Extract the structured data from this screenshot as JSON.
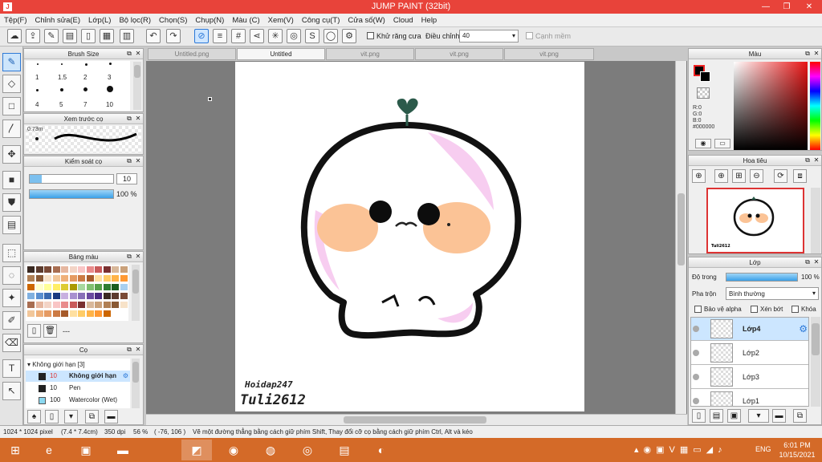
{
  "title": "JUMP PAINT (32bit)",
  "menu": [
    "Tệp(F)",
    "Chỉnh sửa(E)",
    "Lớp(L)",
    "Bộ lọc(R)",
    "Chọn(S)",
    "Chụp(N)",
    "Màu (C)",
    "Xem(V)",
    "Công cụ(T)",
    "Cửa số(W)",
    "Cloud",
    "Help"
  ],
  "toolbar": {
    "antialias_label": "Khử răng cưa",
    "adjust_label": "Điều chỉnh",
    "brush_value": "40",
    "edge_label": "Cạnh mềm"
  },
  "tabs": [
    "Untitled.png",
    "Untitled",
    "vit.png",
    "vit.png",
    "vit.png"
  ],
  "brush_size": {
    "title": "Brush Size",
    "labels": [
      "1",
      "1.5",
      "2",
      "3",
      "4",
      "5",
      "7",
      "10"
    ]
  },
  "preview": {
    "title": "Xem trước cọ",
    "size": "0.73m"
  },
  "control": {
    "title": "Kiểm soát cọ",
    "size": "10",
    "opacity": "100 %",
    "opacity_fraction": 1.0
  },
  "palette": {
    "title": "Bảng màu",
    "more": "---"
  },
  "brush_list": {
    "title": "Cọ",
    "group": "Không giới hạn [3]",
    "items": [
      {
        "size": "10",
        "name": "Không giới hạn"
      },
      {
        "size": "10",
        "name": "Pen"
      },
      {
        "size": "100",
        "name": "Watercolor (Wet)"
      }
    ]
  },
  "color": {
    "title": "Màu",
    "r": "R:0",
    "g": "G:0",
    "b": "B:0",
    "hex": "#000000"
  },
  "navigator": {
    "title": "Hoa tiêu"
  },
  "layers": {
    "title": "Lớp",
    "opacity_label": "Độ trong",
    "opacity": "100 %",
    "opacity_fraction": 1.0,
    "blend_label": "Pha trộn",
    "blend": "Bình thường",
    "protect_alpha": "Bảo vệ alpha",
    "clipping": "Xén bớt",
    "lock": "Khóa",
    "items": [
      "Lớp4",
      "Lớp2",
      "Lớp3",
      "Lớp1"
    ]
  },
  "canvas_text": {
    "line1": "Hoidap247",
    "line2": "Tuli2612"
  },
  "status": {
    "size": "1024 * 1024 pixel",
    "cm": "(7.4 * 7.4cm)",
    "dpi": "350 dpi",
    "zoom": "56 %",
    "coords": "( -76, 106 )",
    "hint": "Vẽ một đường thẳng bằng cách giữ phím Shift, Thay đổi cỡ cọ bằng cách giữ phím Ctrl, Alt và kéo"
  },
  "taskbar": {
    "lang": "ENG",
    "time": "6:01 PM",
    "date": "10/15/2021"
  }
}
